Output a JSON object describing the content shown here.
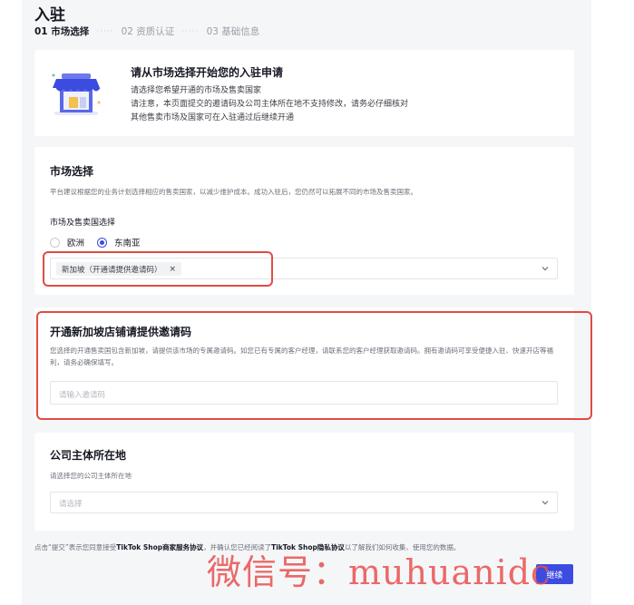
{
  "header": {
    "title": "入驻",
    "steps": [
      {
        "label": "01 市场选择",
        "active": true
      },
      {
        "label": "02 资质认证",
        "active": false
      },
      {
        "label": "03 基础信息",
        "active": false
      }
    ],
    "separator": "·····"
  },
  "intro": {
    "illustration_icon": "storefront-icon",
    "title": "请从市场选择开始您的入驻申请",
    "lines": [
      "请选择您希望开通的市场及售卖国家",
      "请注意，本页面提交的邀请码及公司主体所在地不支持修改，请务必仔细核对",
      "其他售卖市场及国家可在入驻通过后继续开通"
    ]
  },
  "market": {
    "title": "市场选择",
    "description": "平台建议根据您的业务计划选择相应的售卖国家，以减少维护成本。成功入驻后，您仍然可以拓展不同的市场及售卖国家。",
    "field_label": "市场及售卖国选择",
    "radios": [
      {
        "label": "欧洲",
        "checked": false
      },
      {
        "label": "东南亚",
        "checked": true
      }
    ],
    "selected_tag": "新加坡（开通请提供邀请码）",
    "tag_remove": "×"
  },
  "invite": {
    "title": "开通新加坡店铺请提供邀请码",
    "description": "您选择的开通售卖国包含新加坡，请提供该市场的专属邀请码。如您已有专属的客户经理，请联系您的客户经理获取邀请码。拥有邀请码可享受便捷入驻、快速开店等福利，请务必确保填写。",
    "input_placeholder": "请输入邀请码"
  },
  "company": {
    "title": "公司主体所在地",
    "description": "请选择您的公司主体所在地",
    "select_placeholder": "请选择"
  },
  "footer": {
    "agreement_prefix": "点击“提交”表示您同意接受",
    "merchant_link": "TikTok Shop商家服务协议",
    "agreement_middle": "，并确认您已经阅读了",
    "privacy_link": "TikTok Shop隐私协议",
    "agreement_suffix": "以了解我们如何收集、使用您的数据。",
    "continue_label": "继续"
  },
  "watermark": "微信号：muhuanidc",
  "colors": {
    "accent": "#3c4be0",
    "highlight": "#e24b43",
    "background": "#f5f6f8"
  }
}
